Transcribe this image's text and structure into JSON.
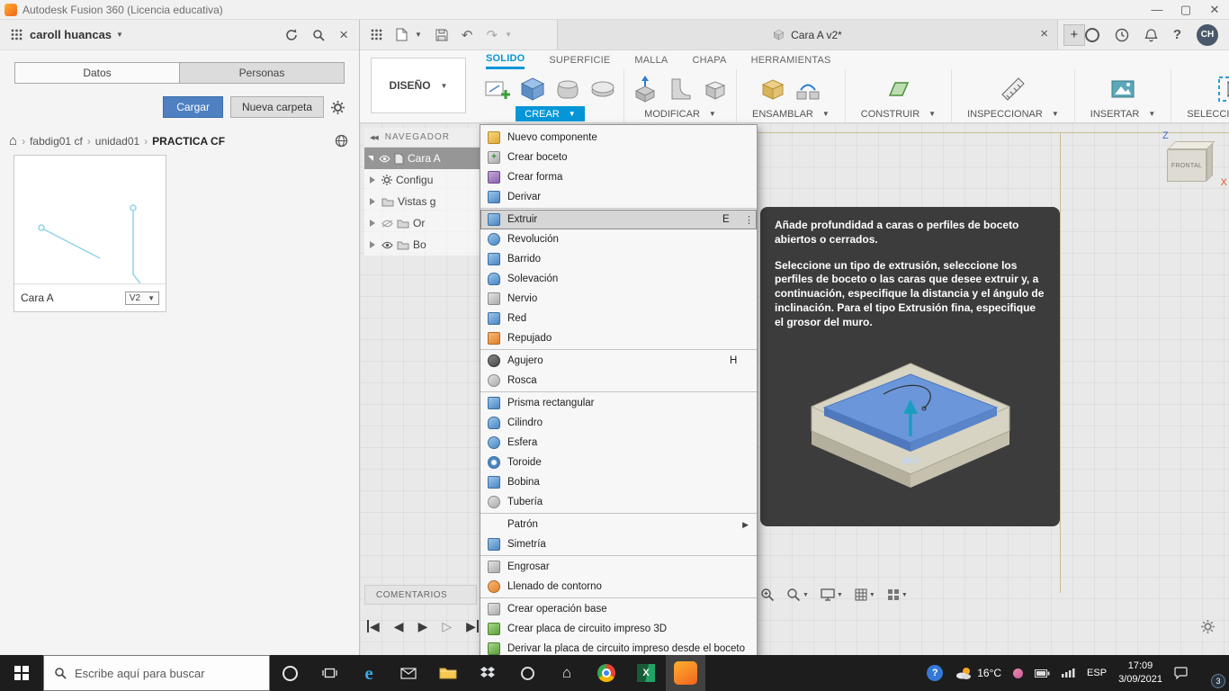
{
  "titlebar": {
    "app_title": "Autodesk Fusion 360 (Licencia educativa)"
  },
  "data_panel": {
    "account_name": "caroll huancas",
    "tab_datos": "Datos",
    "tab_personas": "Personas",
    "upload_button": "Cargar",
    "new_folder_button": "Nueva carpeta",
    "breadcrumb": {
      "folder1": "fabdig01 cf",
      "folder2": "unidad01",
      "current": "PRACTICA CF"
    },
    "document_card": {
      "title": "Cara A",
      "version": "V2"
    }
  },
  "document_bar": {
    "active_tab_title": "Cara A v2*",
    "avatar_initials": "CH"
  },
  "ribbon": {
    "workspace": "DISEÑO",
    "tab_solido": "SOLIDO",
    "tab_superficie": "SUPERFICIE",
    "tab_malla": "MALLA",
    "tab_chapa": "CHAPA",
    "tab_herramientas": "HERRAMIENTAS",
    "group_crear": "CREAR",
    "group_modificar": "MODIFICAR",
    "group_ensamblar": "ENSAMBLAR",
    "group_construir": "CONSTRUIR",
    "group_inspeccionar": "INSPECCIONAR",
    "group_insertar": "INSERTAR",
    "group_seleccionar": "SELECCIONAR"
  },
  "create_menu": {
    "items": [
      {
        "label": "Nuevo componente"
      },
      {
        "label": "Crear boceto"
      },
      {
        "label": "Crear forma"
      },
      {
        "label": "Derivar"
      },
      {
        "label": "Extruir",
        "shortcut": "E"
      },
      {
        "label": "Revolución"
      },
      {
        "label": "Barrido"
      },
      {
        "label": "Solevación"
      },
      {
        "label": "Nervio"
      },
      {
        "label": "Red"
      },
      {
        "label": "Repujado"
      },
      {
        "label": "Agujero",
        "shortcut": "H"
      },
      {
        "label": "Rosca"
      },
      {
        "label": "Prisma rectangular"
      },
      {
        "label": "Cilindro"
      },
      {
        "label": "Esfera"
      },
      {
        "label": "Toroide"
      },
      {
        "label": "Bobina"
      },
      {
        "label": "Tubería"
      },
      {
        "label": "Patrón"
      },
      {
        "label": "Simetría"
      },
      {
        "label": "Engrosar"
      },
      {
        "label": "Llenado de contorno"
      },
      {
        "label": "Crear operación base"
      },
      {
        "label": "Crear placa de circuito impreso 3D"
      },
      {
        "label": "Derivar la placa de circuito impreso desde el boceto"
      }
    ]
  },
  "extrude_tooltip": {
    "summary": "Añade profundidad a caras o perfiles de boceto abiertos o cerrados.",
    "details": "Seleccione un tipo de extrusión, seleccione los perfiles de boceto o las caras que desee extruir y, a continuación, especifique la distancia y el ángulo de inclinación. Para el tipo Extrusión fina, especifique el grosor del muro.",
    "dimension_label": "1000"
  },
  "navigator": {
    "title": "NAVEGADOR",
    "root_label": "Cara A",
    "items": [
      {
        "label": "Configu"
      },
      {
        "label": "Vistas g"
      },
      {
        "label": "Or"
      },
      {
        "label": "Bo"
      }
    ]
  },
  "viewcube": {
    "front_face": "FRONTAL",
    "axis_z": "Z",
    "axis_x": "X"
  },
  "comments_bar": {
    "label": "COMENTARIOS"
  },
  "taskbar": {
    "search_placeholder": "Escribe aquí para buscar",
    "weather": "16°C",
    "language": "ESP",
    "time": "17:09",
    "date": "3/09/2021",
    "notifications_badge": "3"
  }
}
